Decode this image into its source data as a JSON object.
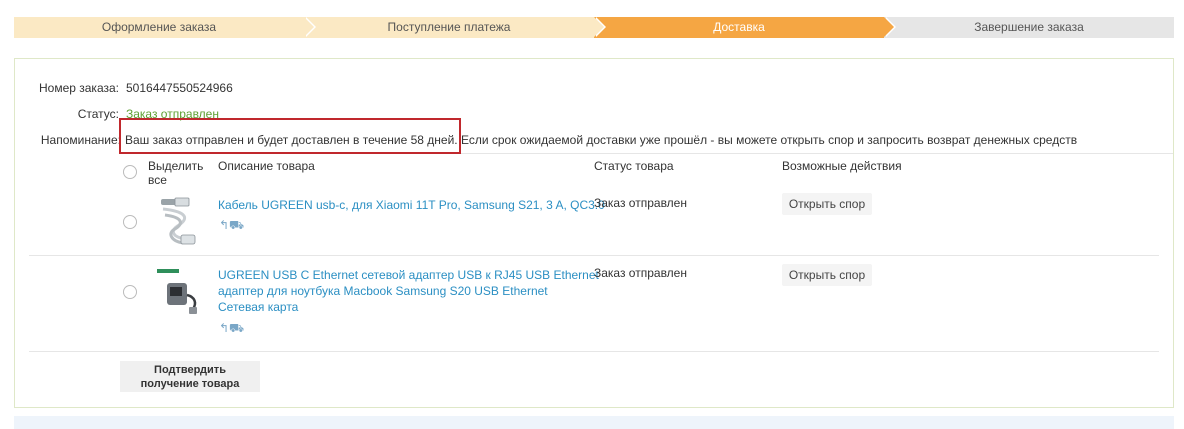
{
  "steps": [
    {
      "label": "Оформление заказа",
      "state": "done"
    },
    {
      "label": "Поступление платежа",
      "state": "done"
    },
    {
      "label": "Доставка",
      "state": "active"
    },
    {
      "label": "Завершение заказа",
      "state": "todo"
    }
  ],
  "order": {
    "number_label": "Номер заказа:",
    "number_value": "5016447550524966",
    "status_label": "Статус:",
    "status_value": "Заказ отправлен",
    "reminder_label": "Напоминание:",
    "reminder_text": "Ваш заказ отправлен и будет доставлен в течение 58 дней. Если срок ожидаемой доставки уже прошёл - вы можете открыть спор и запросить возврат денежных средств"
  },
  "table": {
    "select_all_label_1": "Выделить",
    "select_all_label_2": "все",
    "col_description": "Описание товара",
    "col_status": "Статус товара",
    "col_actions": "Возможные действия"
  },
  "items": [
    {
      "title": "Кабель UGREEN usb-c, для Xiaomi 11T Pro, Samsung S21, 3 A, QC3.0",
      "status": "Заказ отправлен",
      "action": "Открыть спор"
    },
    {
      "title_line1": "UGREEN USB C Ethernet сетевой адаптер USB к RJ45 USB Ethernet",
      "title_line2": "адаптер для ноутбука Macbook Samsung S20 USB Ethernet",
      "title_line3": "Сетевая карта",
      "status": "Заказ отправлен",
      "action": "Открыть спор"
    }
  ],
  "confirm": {
    "line1": "Подтвердить",
    "line2": "получение товара"
  },
  "colors": {
    "step_done": "#fbe9c4",
    "step_active": "#f5a643",
    "step_todo": "#e6e6e6",
    "link": "#2b8fc3",
    "status_green": "#5fa134",
    "highlight_border": "#c0282d"
  }
}
